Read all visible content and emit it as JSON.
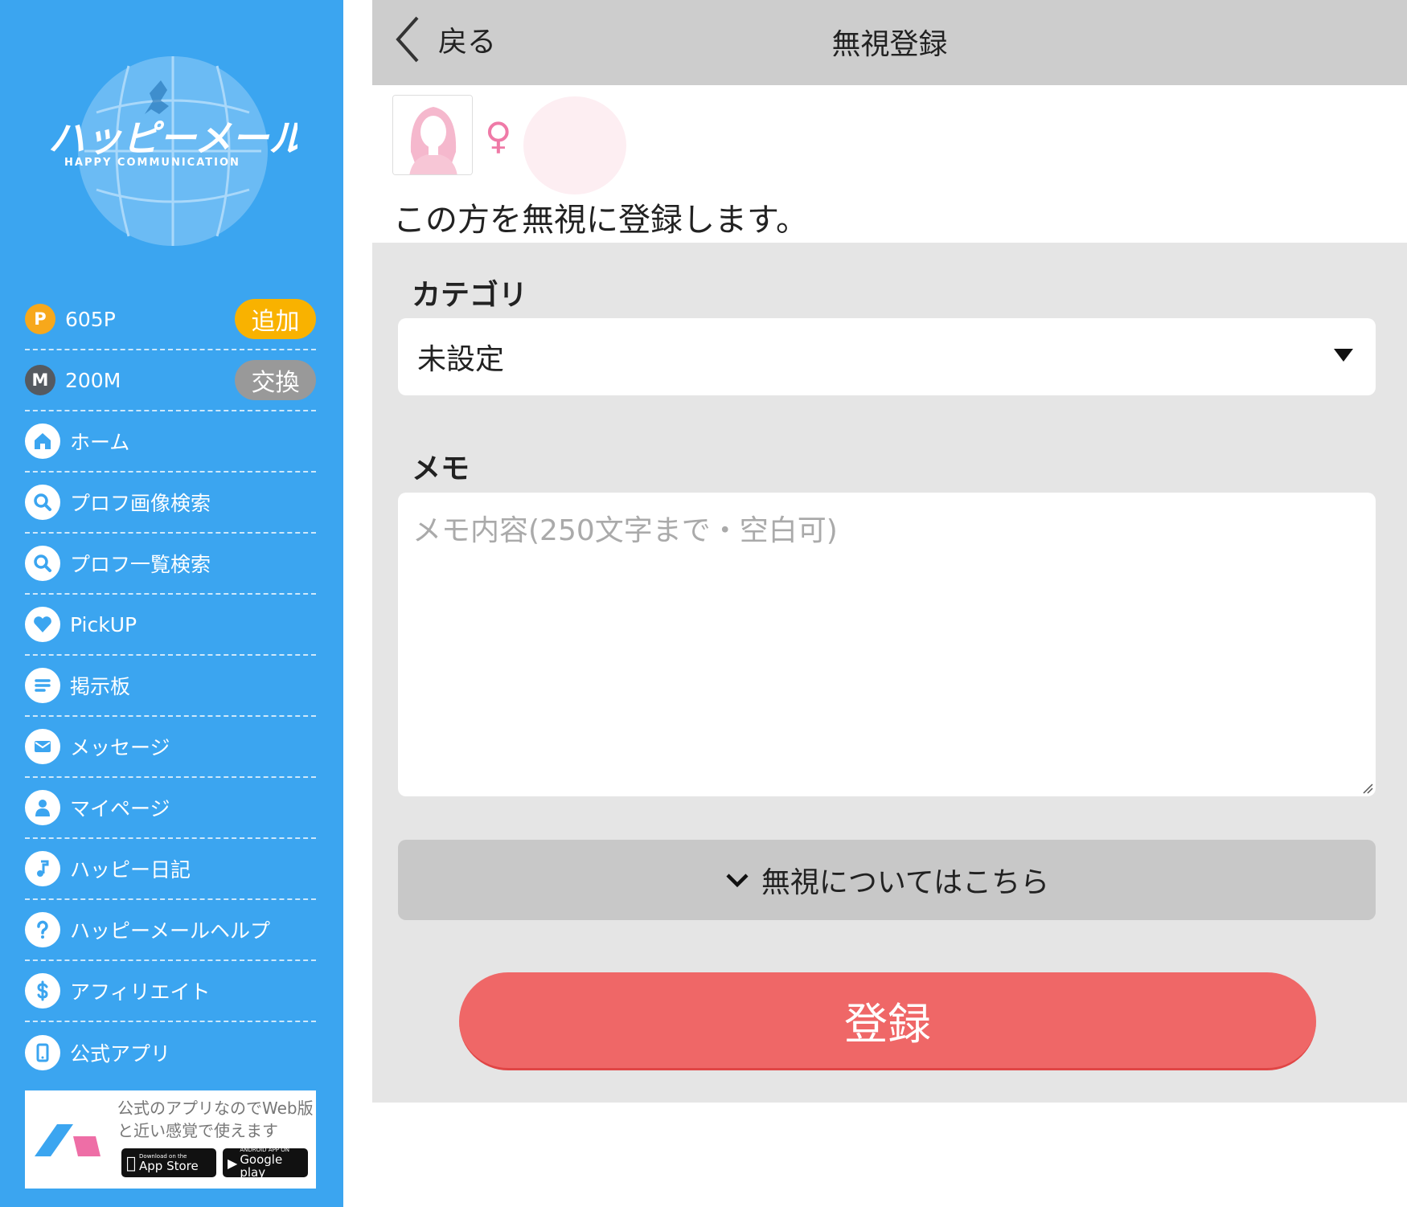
{
  "sidebar": {
    "logo": {
      "brand": "ハッピーメール",
      "tagline": "HAPPY COMMUNICATION"
    },
    "points": {
      "value": "605P",
      "button": "追加",
      "coin": "P"
    },
    "mileage": {
      "value": "200M",
      "button": "交換",
      "coin": "M"
    },
    "items": [
      {
        "label": "ホーム",
        "icon": "home-icon"
      },
      {
        "label": "プロフ画像検索",
        "icon": "search-icon"
      },
      {
        "label": "プロフ一覧検索",
        "icon": "search-icon"
      },
      {
        "label": "PickUP",
        "icon": "heart-icon"
      },
      {
        "label": "掲示板",
        "icon": "list-icon"
      },
      {
        "label": "メッセージ",
        "icon": "mail-icon"
      },
      {
        "label": "マイページ",
        "icon": "user-icon"
      },
      {
        "label": "ハッピー日記",
        "icon": "music-note-icon"
      },
      {
        "label": "ハッピーメールヘルプ",
        "icon": "question-icon"
      },
      {
        "label": "アフィリエイト",
        "icon": "dollar-icon"
      },
      {
        "label": "公式アプリ",
        "icon": "phone-icon"
      }
    ],
    "app_banner": {
      "text": "公式のアプリなのでWeb版と近い感覚で使えます",
      "apple_small": "Download on the",
      "apple_big": "App Store",
      "google_small": "ANDROID APP ON",
      "google_big": "Google play"
    }
  },
  "header": {
    "back_label": "戻る",
    "title": "無視登録"
  },
  "profile": {
    "gender_symbol": "♀",
    "confirm_text": "この方を無視に登録します。"
  },
  "form": {
    "category_label": "カテゴリ",
    "category_value": "未設定",
    "memo_label": "メモ",
    "memo_placeholder": "メモ内容(250文字まで・空白可)",
    "memo_value": "",
    "about_label": "無視についてはこちら",
    "submit_label": "登録"
  },
  "colors": {
    "sidebar_bg": "#3ba5f0",
    "header_bg": "#cdcdcd",
    "form_bg": "#e5e5e5",
    "submit_bg": "#ef6767",
    "points_pill": "#f9b200",
    "mileage_pill": "#999999",
    "gender": "#ef7aa7"
  }
}
